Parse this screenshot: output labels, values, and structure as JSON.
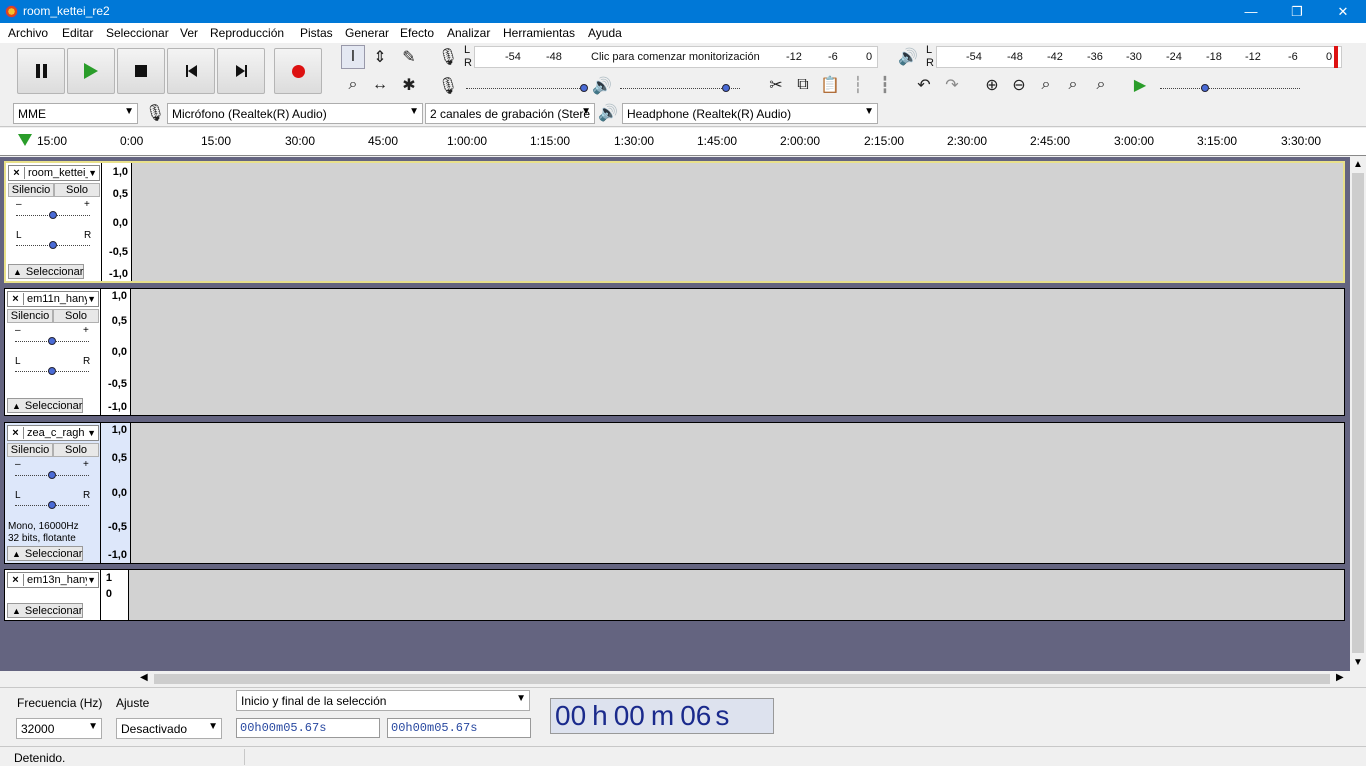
{
  "window": {
    "title": "room_kettei_re2"
  },
  "menu": [
    "Archivo",
    "Editar",
    "Seleccionar",
    "Ver",
    "Reproducción",
    "Pistas",
    "Generar",
    "Efecto",
    "Analizar",
    "Herramientas",
    "Ayuda"
  ],
  "meters": {
    "record_scale": [
      "-54",
      "-48",
      "-12",
      "-6",
      "0"
    ],
    "record_hint": "Clic para comenzar monitorización",
    "play_scale": [
      "-54",
      "-48",
      "-42",
      "-36",
      "-30",
      "-24",
      "-18",
      "-12",
      "-6",
      "0"
    ],
    "lr": [
      "L",
      "R"
    ]
  },
  "devices": {
    "host": "MME",
    "mic": "Micrófono (Realtek(R) Audio)",
    "channels": "2 canales de grabación (Stere",
    "output": "Headphone (Realtek(R) Audio)"
  },
  "ruler": [
    "15:00",
    "0:00",
    "15:00",
    "30:00",
    "45:00",
    "1:00:00",
    "1:15:00",
    "1:30:00",
    "1:45:00",
    "2:00:00",
    "2:15:00",
    "2:30:00",
    "2:45:00",
    "3:00:00",
    "3:15:00",
    "3:30:00"
  ],
  "track_controls": {
    "mute": "Silencio",
    "solo": "Solo",
    "select": "Seleccionar",
    "minus": "–",
    "plus": "+",
    "left": "L",
    "right": "R"
  },
  "tracks": [
    {
      "name": "room_kettei_",
      "scale": [
        "1,0",
        "0,5",
        "0,0",
        "-0,5",
        "-1,0"
      ],
      "info": ""
    },
    {
      "name": "em11n_hany",
      "scale": [
        "1,0",
        "0,5",
        "0,0",
        "-0,5",
        "-1,0"
      ],
      "info": ""
    },
    {
      "name": "zea_c_ragh",
      "scale": [
        "1,0",
        "0,5",
        "0,0",
        "-0,5",
        "-1,0"
      ],
      "info": "Mono, 16000Hz\n32 bits, flotante"
    },
    {
      "name": "em13n_hany",
      "scale": [
        "1",
        "0"
      ],
      "info": ""
    }
  ],
  "selection": {
    "rate_label": "Frecuencia (Hz)",
    "rate": "32000",
    "snap_label": "Ajuste",
    "snap": "Desactivado",
    "mode": "Inicio y final de la selección",
    "start": "00h00m05.67s",
    "end": "00h00m05.67s",
    "time_h": "00",
    "time_m": "00",
    "time_s": "06",
    "h": "h",
    "m": "m",
    "s": "s"
  },
  "status": "Detenido.",
  "colors": {
    "titlebar": "#0078d7",
    "track_bg": "#d2d2d2",
    "track_area": "#646480",
    "record": "#d11",
    "play": "#2a9d2a"
  }
}
